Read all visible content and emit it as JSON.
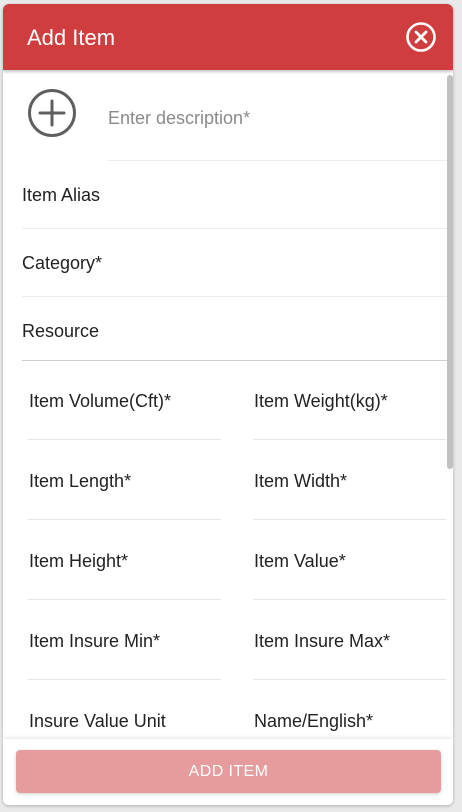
{
  "dialog": {
    "title": "Add Item",
    "close_icon": "close-circle-icon"
  },
  "form": {
    "add_icon": "plus-circle-icon",
    "description": {
      "value": "",
      "placeholder": "Enter description*"
    },
    "item_alias": {
      "label": "Item Alias",
      "value": ""
    },
    "category": {
      "label": "Category*",
      "value": ""
    },
    "resource": {
      "label": "Resource",
      "value": ""
    },
    "item_volume": {
      "label": "Item Volume(Cft)*",
      "value": ""
    },
    "item_weight": {
      "label": "Item Weight(kg)*",
      "value": ""
    },
    "item_length": {
      "label": "Item Length*",
      "value": ""
    },
    "item_width": {
      "label": "Item Width*",
      "value": ""
    },
    "item_height": {
      "label": "Item Height*",
      "value": ""
    },
    "item_value": {
      "label": "Item Value*",
      "value": ""
    },
    "item_insure_min": {
      "label": "Item Insure Min*",
      "value": ""
    },
    "item_insure_max": {
      "label": "Item Insure Max*",
      "value": ""
    },
    "insure_value_unit": {
      "label": "Insure Value Unit",
      "value": ""
    },
    "name_english": {
      "label": "Name/English*",
      "value": ""
    }
  },
  "footer": {
    "add_button_label": "ADD ITEM",
    "add_button_state": "disabled"
  },
  "colors": {
    "header": "#d03d3e",
    "button_disabled": "#e69c9d",
    "text": "#222222",
    "placeholder": "#8a8a8a"
  }
}
